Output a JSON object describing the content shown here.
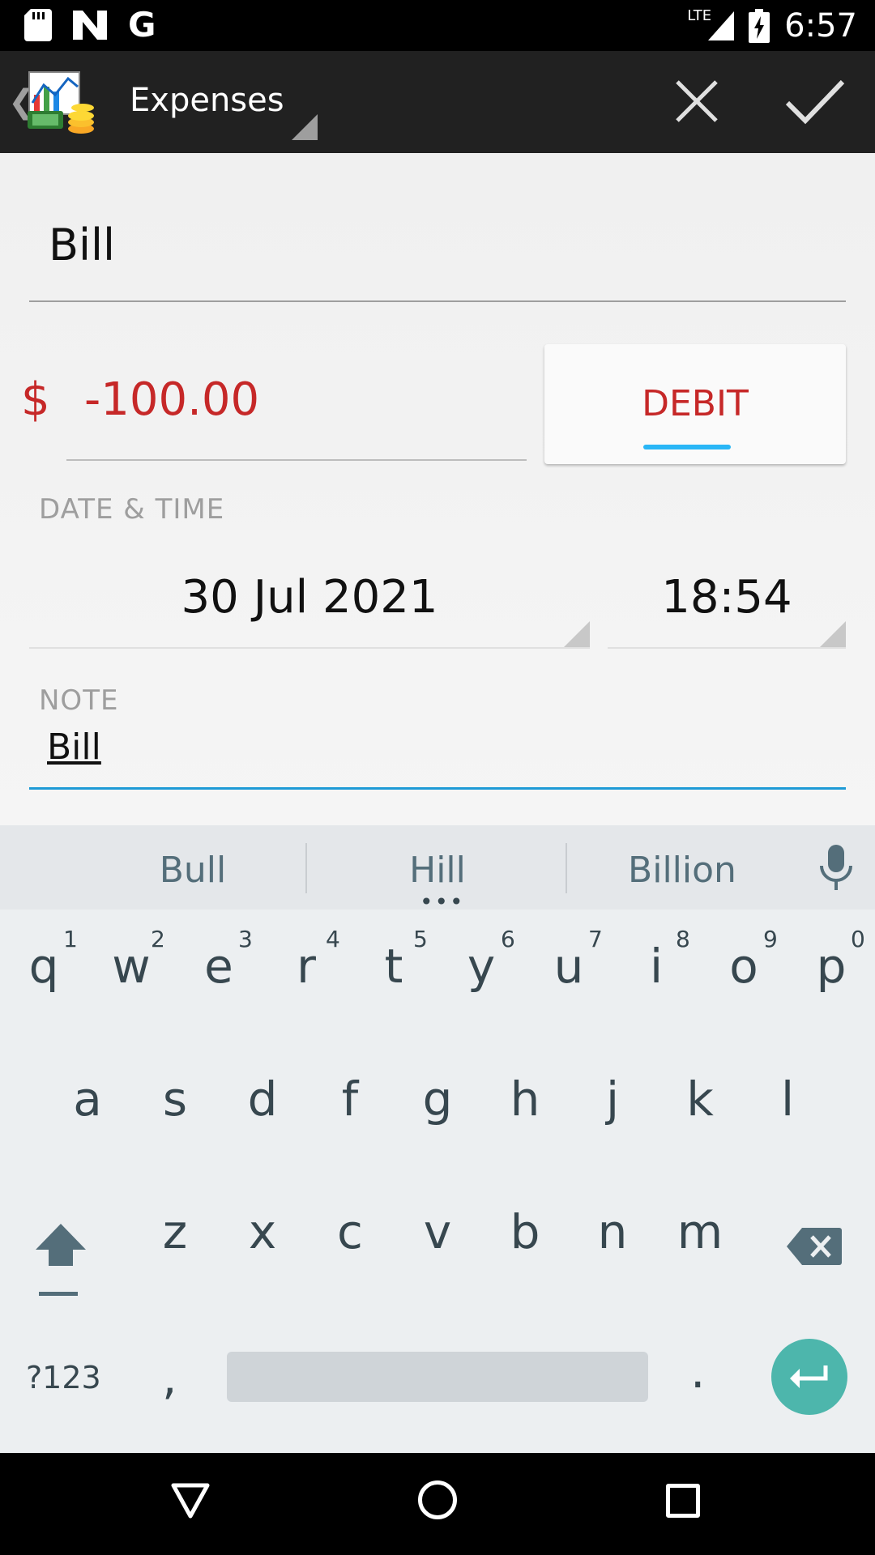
{
  "status_bar": {
    "time": "6:57",
    "network": "LTE",
    "notification_icons": [
      "sd-card-icon",
      "n-app-icon",
      "google-icon"
    ],
    "google_glyph": "G"
  },
  "app_bar": {
    "title": "Expenses",
    "back_glyph": "❮",
    "close_label": "close-icon",
    "confirm_label": "check-icon"
  },
  "form": {
    "title_value": "Bill",
    "currency_symbol": "$",
    "amount_value": "-100.00",
    "type_button_label": "DEBIT",
    "date_time_label": "DATE & TIME",
    "date_value": "30 Jul 2021",
    "time_value": "18:54",
    "note_label": "NOTE",
    "note_value": "Bill"
  },
  "keyboard": {
    "suggestions": [
      "Bull",
      "Hill",
      "Billion"
    ],
    "row1": [
      {
        "key": "q",
        "hint": "1"
      },
      {
        "key": "w",
        "hint": "2"
      },
      {
        "key": "e",
        "hint": "3"
      },
      {
        "key": "r",
        "hint": "4"
      },
      {
        "key": "t",
        "hint": "5"
      },
      {
        "key": "y",
        "hint": "6"
      },
      {
        "key": "u",
        "hint": "7"
      },
      {
        "key": "i",
        "hint": "8"
      },
      {
        "key": "o",
        "hint": "9"
      },
      {
        "key": "p",
        "hint": "0"
      }
    ],
    "row2": [
      "a",
      "s",
      "d",
      "f",
      "g",
      "h",
      "j",
      "k",
      "l"
    ],
    "row3": [
      "z",
      "x",
      "c",
      "v",
      "b",
      "n",
      "m"
    ],
    "symbols_label": "?123",
    "comma": ",",
    "period": "."
  },
  "colors": {
    "amount_red": "#c62828",
    "accent_blue": "#1e9ad6",
    "enter_teal": "#4db6ac"
  }
}
